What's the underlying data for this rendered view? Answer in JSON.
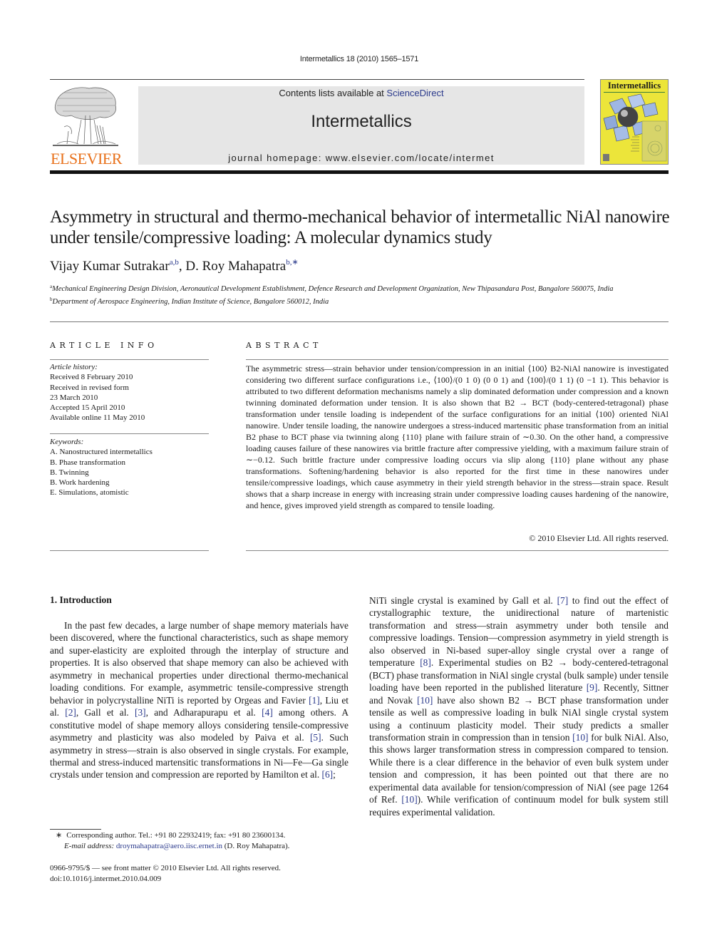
{
  "header": {
    "journal_ref": "Intermetallics 18 (2010) 1565–1571",
    "contents_prefix": "Contents lists available at ",
    "contents_link": "ScienceDirect",
    "journal_title": "Intermetallics",
    "homepage": "journal homepage: www.elsevier.com/locate/intermet",
    "publisher_wordmark": "ELSEVIER",
    "cover_title": "Intermetallics",
    "colors": {
      "publisher_orange": "#e8701a",
      "link_blue": "#2b3a8c",
      "cover_yellow": "#ece53a",
      "banner_grey": "#e6e6e6"
    }
  },
  "article": {
    "title": "Asymmetry in structural and thermo-mechanical behavior of intermetallic NiAl nanowire under tensile/compressive loading: A molecular dynamics study",
    "authors": [
      {
        "name": "Vijay Kumar Sutrakar",
        "sup": "a,b"
      },
      {
        "name": "D. Roy Mahapatra",
        "sup": "b,∗"
      }
    ],
    "author_separator": ", ",
    "affiliations": [
      {
        "mark": "a",
        "text": "Mechanical Engineering Design Division, Aeronautical Development Establishment, Defence Research and Development Organization, New Thipasandara Post, Bangalore 560075, India"
      },
      {
        "mark": "b",
        "text": "Department of Aerospace Engineering, Indian Institute of Science, Bangalore 560012, India"
      }
    ]
  },
  "article_info": {
    "heading": "ARTICLE INFO",
    "history_label": "Article history:",
    "history": [
      "Received 8 February 2010",
      "Received in revised form",
      "23 March 2010",
      "Accepted 15 April 2010",
      "Available online 11 May 2010"
    ],
    "keywords_label": "Keywords:",
    "keywords": [
      "A. Nanostructured intermetallics",
      "B. Phase transformation",
      "B. Twinning",
      "B. Work hardening",
      "E. Simulations, atomistic"
    ]
  },
  "abstract": {
    "heading": "ABSTRACT",
    "text": "The asymmetric stress—strain behavior under tension/compression in an initial ⟨100⟩ B2-NiAl nanowire is investigated considering two different surface configurations i.e., ⟨100⟩/(0 1 0) (0 0 1) and ⟨100⟩/(0 1 1) (0 −1 1). This behavior is attributed to two different deformation mechanisms namely a slip dominated deformation under compression and a known twinning dominated deformation under tension. It is also shown that B2 → BCT (body-centered-tetragonal) phase transformation under tensile loading is independent of the surface configurations for an initial ⟨100⟩ oriented NiAl nanowire. Under tensile loading, the nanowire undergoes a stress-induced martensitic phase transformation from an initial B2 phase to BCT phase via twinning along {110} plane with failure strain of ∼0.30. On the other hand, a compressive loading causes failure of these nanowires via brittle fracture after compressive yielding, with a maximum failure strain of ∼−0.12. Such brittle fracture under compressive loading occurs via slip along {110} plane without any phase transformations. Softening/hardening behavior is also reported for the first time in these nanowires under tensile/compressive loadings, which cause asymmetry in their yield strength behavior in the stress—strain space. Result shows that a sharp increase in energy with increasing strain under compressive loading causes hardening of the nanowire, and hence, gives improved yield strength as compared to tensile loading.",
    "copyright": "© 2010 Elsevier Ltd. All rights reserved."
  },
  "body": {
    "section_heading": "1.  Introduction",
    "left_segments": [
      {
        "t": "In the past few decades, a large number of shape memory materials have been discovered, where the functional characteristics, such as shape memory and super-elasticity are exploited through the interplay of structure and properties. It is also observed that shape memory can also be achieved with asymmetry in mechanical properties under directional thermo-mechanical loading conditions. For example, asymmetric tensile-compressive strength behavior in polycrystalline NiTi is reported by Orgeas and Favier "
      },
      {
        "ref": "[1]"
      },
      {
        "t": ", Liu et al. "
      },
      {
        "ref": "[2]"
      },
      {
        "t": ", Gall et al. "
      },
      {
        "ref": "[3]"
      },
      {
        "t": ", and Adharapurapu et al. "
      },
      {
        "ref": "[4]"
      },
      {
        "t": " among others. A constitutive model of shape memory alloys considering tensile-compressive asymmetry and plasticity was also modeled by Paiva et al. "
      },
      {
        "ref": "[5]"
      },
      {
        "t": ". Such asymmetry in stress—strain is also observed in single crystals. For example, thermal and stress-induced martensitic transformations in Ni—Fe—Ga single crystals under tension and compression are reported by Hamilton et al. "
      },
      {
        "ref": "[6]"
      },
      {
        "t": ";"
      }
    ],
    "right_segments": [
      {
        "t": "NiTi single crystal is examined by Gall et al. "
      },
      {
        "ref": "[7]"
      },
      {
        "t": " to find out the effect of crystallographic texture, the unidirectional nature of martenistic transformation and stress—strain asymmetry under both tensile and compressive loadings. Tension—compression asymmetry in yield strength is also observed in Ni-based super-alloy single crystal over a range of temperature "
      },
      {
        "ref": "[8]"
      },
      {
        "t": ". Experimental studies on B2 → body-centered-tetragonal (BCT) phase transformation in NiAl single crystal (bulk sample) under tensile loading have been reported in the published literature "
      },
      {
        "ref": "[9]"
      },
      {
        "t": ". Recently, Sittner and Novak "
      },
      {
        "ref": "[10]"
      },
      {
        "t": " have also shown B2 → BCT phase transformation under tensile as well as compressive loading in bulk NiAl single crystal system using a continuum plasticity model. Their study predicts a smaller transformation strain in compression than in tension "
      },
      {
        "ref": "[10]"
      },
      {
        "t": " for bulk NiAl. Also, this shows larger transformation stress in compression compared to tension. While there is a clear difference in the behavior of even bulk system under tension and compression, it has been pointed out that there are no experimental data available for tension/compression of NiAl (see page 1264 of Ref. "
      },
      {
        "ref": "[10]"
      },
      {
        "t": "). While verification of continuum model for bulk system still requires experimental validation."
      }
    ]
  },
  "footnote": {
    "marker": "∗",
    "corresponding": "Corresponding author. Tel.: +91 80 22932419; fax: +91 80 23600134.",
    "email_label": "E-mail address:",
    "email": "droymahapatra@aero.iisc.ernet.in",
    "email_suffix": " (D. Roy Mahapatra)."
  },
  "front_matter": {
    "issn_line": "0966-9795/$ — see front matter © 2010 Elsevier Ltd. All rights reserved.",
    "doi": "doi:10.1016/j.intermet.2010.04.009"
  }
}
